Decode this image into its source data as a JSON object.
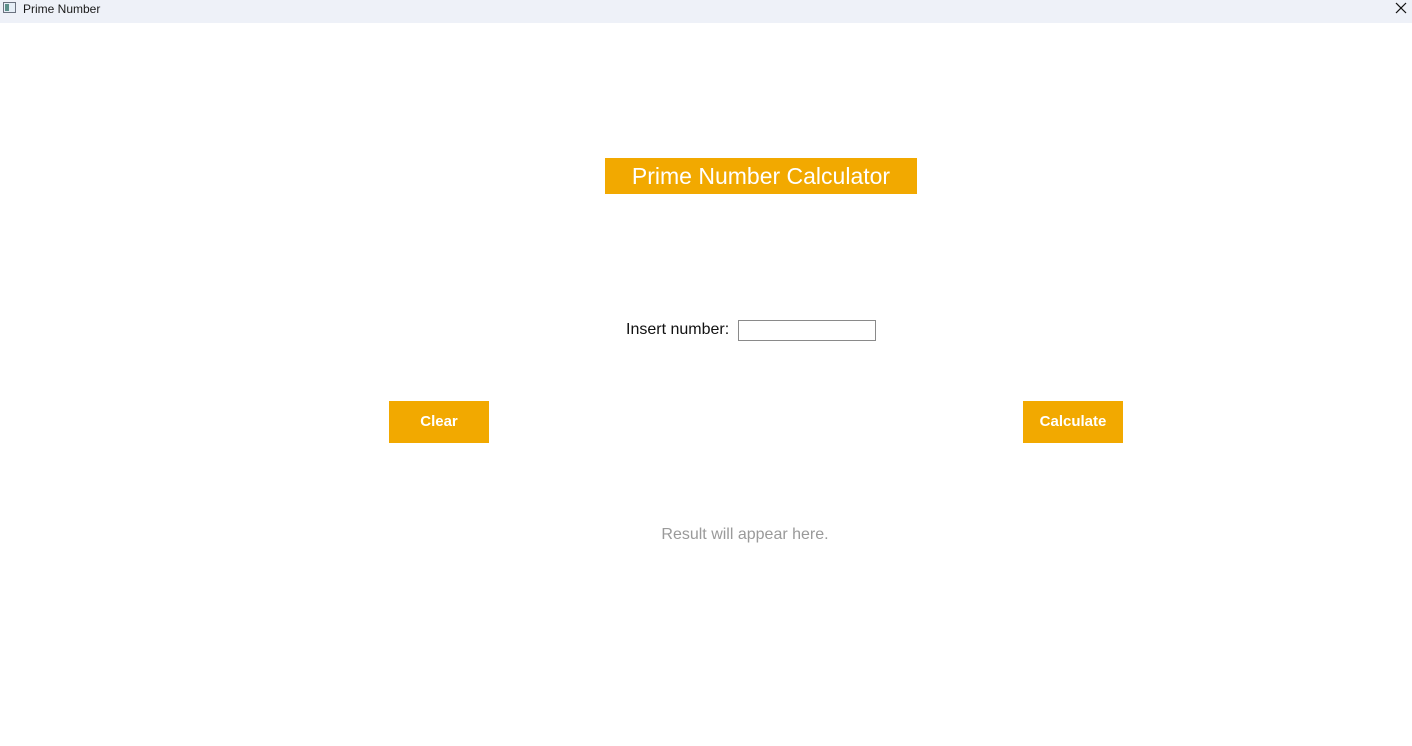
{
  "window": {
    "title": "Prime Number",
    "icons": {
      "app": "app-window-icon",
      "close": "close-icon"
    }
  },
  "header": {
    "title": "Prime Number Calculator"
  },
  "form": {
    "label": "Insert number:",
    "input_value": "",
    "input_placeholder": ""
  },
  "buttons": {
    "clear_label": "Clear",
    "calculate_label": "Calculate"
  },
  "result": {
    "text": "Result will appear here."
  },
  "colors": {
    "accent": "#f2a900",
    "titlebar": "#eef1f8",
    "result_text": "#9a9a9a"
  }
}
